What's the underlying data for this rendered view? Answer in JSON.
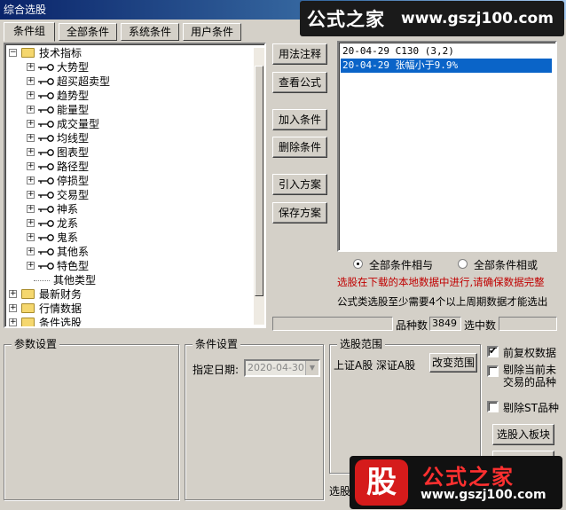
{
  "window": {
    "title": "综合选股"
  },
  "brand": {
    "name": "公式之家",
    "url": "www.gszj100.com"
  },
  "tabs": [
    "条件组",
    "全部条件",
    "系统条件",
    "用户条件"
  ],
  "tree": {
    "root": "技术指标",
    "children": [
      "大势型",
      "超买超卖型",
      "趋势型",
      "能量型",
      "成交量型",
      "均线型",
      "图表型",
      "路径型",
      "停损型",
      "交易型",
      "神系",
      "龙系",
      "鬼系",
      "其他系",
      "特色型",
      "其他类型"
    ],
    "top_level": [
      "最新财务",
      "行情数据",
      "条件选股"
    ]
  },
  "buttons": {
    "usage_note": "用法注释",
    "view_formula": "查看公式",
    "add_condition": "加入条件",
    "delete_condition": "删除条件",
    "import_scheme": "引入方案",
    "save_scheme": "保存方案",
    "change_range": "改变范围",
    "select_to_block": "选股入板块"
  },
  "conditions_list": [
    {
      "text": "20-04-29 C130 (3,2)",
      "selected": false
    },
    {
      "text": "20-04-29 张幅小于9.9%",
      "selected": true
    }
  ],
  "logic": {
    "and_label": "全部条件相与",
    "or_label": "全部条件相或",
    "selected": "and"
  },
  "notes": {
    "warning": "选股在下载的本地数据中进行,请确保数据完整",
    "cycle_note": "公式类选股至少需要4个以上周期数据才能选出"
  },
  "stats": {
    "count_label": "品种数",
    "count_value": "3849",
    "selected_label": "选中数",
    "selected_value": ""
  },
  "params": {
    "title": "参数设置"
  },
  "cond_settings": {
    "title": "条件设置",
    "date_label": "指定日期:",
    "date_value": "2020-04-30"
  },
  "range": {
    "title": "选股范围",
    "markets": "上证A股 深证A股",
    "bottom_label": "选股"
  },
  "options": {
    "forward_adjust": {
      "label": "前复权数据",
      "checked": true
    },
    "exclude_unlisted": {
      "label": "剔除当前未交易的品种",
      "checked": false
    },
    "exclude_st": {
      "label": "剔除ST品种",
      "checked": false
    }
  },
  "watermark": {
    "badge": "股",
    "title": "公式之家",
    "url": "www.gszj100.com"
  }
}
